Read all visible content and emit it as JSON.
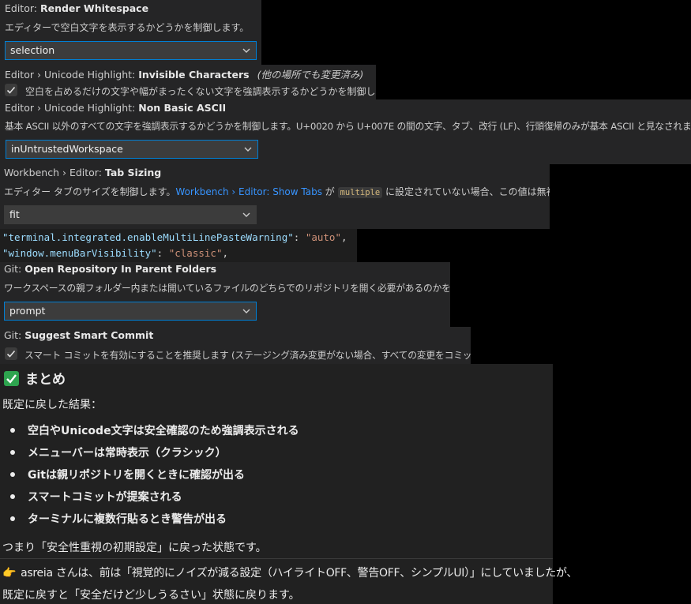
{
  "settings": {
    "render_whitespace": {
      "category": "Editor: ",
      "name": "Render Whitespace",
      "description": "エディターで空白文字を表示するかどうかを制御します。",
      "value": "selection"
    },
    "invisible_chars": {
      "category": "Editor › Unicode Highlight: ",
      "name": "Invisible Characters",
      "modified_note": "(他の場所でも変更済み)",
      "description": "空白を占めるだけの文字や幅がまったくない文字を強調表示するかどうかを制御します。",
      "checked": true
    },
    "non_basic_ascii": {
      "category": "Editor › Unicode Highlight: ",
      "name": "Non Basic ASCII",
      "description": "基本 ASCII 以外のすべての文字を強調表示するかどうかを制御します。U+0020 から U+007E の間の文字、タブ、改行 (LF)、行頭復帰のみが基本 ASCII と見なされます。",
      "value": "inUntrustedWorkspace"
    },
    "tab_sizing": {
      "category": "Workbench › Editor: ",
      "name": "Tab Sizing",
      "desc_before": "エディター タブのサイズを制御します。",
      "desc_link": "Workbench › Editor: Show Tabs",
      "desc_middle": " が ",
      "desc_code": "multiple",
      "desc_after": " に設定されていない場合、この値は無視されます。",
      "value": "fit"
    },
    "json_lines": [
      {
        "key": "\"terminal.integrated.enableMultiLinePasteWarning\"",
        "sep": ": ",
        "val": "\"auto\"",
        "end": ","
      },
      {
        "key": "\"window.menuBarVisibility\"",
        "sep": ": ",
        "val": "\"classic\"",
        "end": ","
      }
    ],
    "open_repo": {
      "category": "Git: ",
      "name": "Open Repository In Parent Folders",
      "description": "ワークスペースの親フォルダー内または開いているファイルのどちらでのリポジトリを開く必要があるのかを制御します。",
      "value": "prompt"
    },
    "smart_commit": {
      "category": "Git: ",
      "name": "Suggest Smart Commit",
      "description": "スマート コミットを有効にすることを推奨します (ステージング済み変更がない場合、すべての変更をコミットします)。",
      "checked": true
    }
  },
  "chat": {
    "heading_emoji": "✅",
    "heading": "まとめ",
    "intro": "既定に戻した結果：",
    "bullets": [
      "空白やUnicode文字は安全確認のため強調表示される",
      "メニューバーは常時表示（クラシック）",
      "Gitは親リポジトリを開くときに確認が出る",
      "スマートコミットが提案される",
      "ターミナルに複数行貼るとき警告が出る"
    ],
    "conclusion": "つまり「安全性重視の初期設定」に戻った状態です。",
    "note_emoji": "👉",
    "note_line1": "asreia さんは、前は「視覚的にノイズが減る設定（ハイライトOFF、警告OFF、シンプルUI）」にしていましたが、",
    "note_line2": "既定に戻すと「安全だけど少しうるさい」状態に戻ります。"
  },
  "colors": {
    "panel_bg": "#252526",
    "chat_bg": "#212121",
    "focus_border": "#007fd4",
    "link": "#3794ff",
    "json_key": "#9cdcfe",
    "json_string": "#ce9178",
    "checkmark_emoji": "#2ea44f"
  }
}
